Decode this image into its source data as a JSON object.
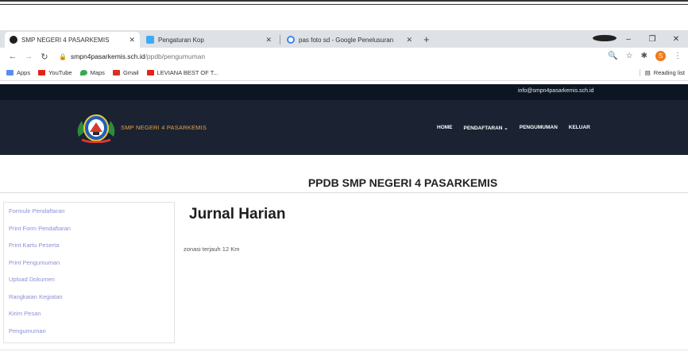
{
  "browser": {
    "tabs": [
      {
        "title": "SMP NEGERI 4 PASARKEMIS",
        "favicon_color": "#1f1f1f",
        "active": true
      },
      {
        "title": "Pengaturan Kop",
        "favicon_color": "#3fa9f5",
        "active": false
      },
      {
        "title": "pas foto sd - Google Penelusuran",
        "favicon_color": "#4285f4",
        "active": false
      }
    ],
    "url_host": "smpn4pasarkemis.sch.id",
    "url_path": "/ppdb/pengumuman",
    "bookmarks": [
      {
        "label": "Apps",
        "color": "#5b8def"
      },
      {
        "label": "YouTube",
        "color": "#e62117"
      },
      {
        "label": "Maps",
        "color": "#34a853"
      },
      {
        "label": "Gmail",
        "color": "#d93025"
      },
      {
        "label": "LEVIANA BEST OF T...",
        "color": "#e62117"
      }
    ],
    "reading_list": "Reading list",
    "profile_initial": "S"
  },
  "site": {
    "email": "info@smpn4pasarkemis.sch.id",
    "name": "SMP NEGERI 4 PASARKEMIS",
    "menu": [
      "HOME",
      "PENDAFTARAN ⌄",
      "PENGUMUMAN",
      "KELUAR"
    ],
    "page_title": "PPDB SMP NEGERI 4 PASARKEMIS",
    "sidebar": [
      "Formulir Pendaftaran",
      "Print Form Pendaftaran",
      "Print Kartu Peserta",
      "Print Pengumuman",
      "Upload Dokumen",
      "Rangkaian Kegiatan",
      "Kirim Pesan",
      "Pengumuman"
    ],
    "main_heading": "Jurnal Harian",
    "main_text": "zonasi terjauh 12 Km",
    "colors": {
      "header_bg": "#1b2232",
      "site_name": "#e8a23a",
      "sidebar_link": "#8c8fd6"
    }
  }
}
